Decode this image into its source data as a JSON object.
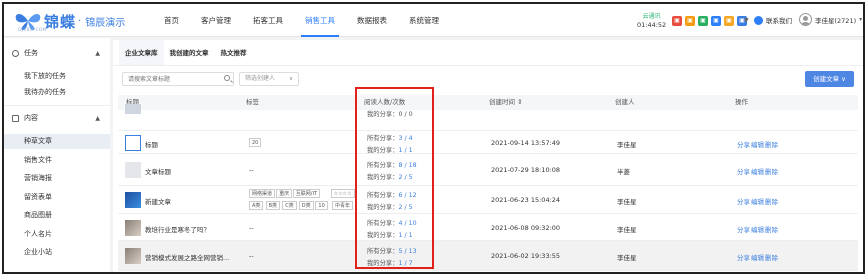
{
  "brand": {
    "name": "锦蝶",
    "dot": "·",
    "product": "锦辰演示",
    "url": "GJCRM.COM"
  },
  "nav": [
    {
      "label": "首页"
    },
    {
      "label": "客户管理"
    },
    {
      "label": "拓客工具"
    },
    {
      "label": "销售工具",
      "active": true
    },
    {
      "label": "数据报表"
    },
    {
      "label": "系统管理"
    }
  ],
  "clock": {
    "label": "云通讯",
    "time": "01:44:52"
  },
  "header_icons": [
    {
      "name": "app-icon-red",
      "color": "#e84c3d",
      "glyph": "▣"
    },
    {
      "name": "app-icon-orange",
      "color": "#f39c12",
      "glyph": "▣"
    },
    {
      "name": "app-icon-green",
      "color": "#27ae60",
      "glyph": "▣"
    },
    {
      "name": "app-icon-blue",
      "color": "#2d7ff9",
      "glyph": "▣"
    },
    {
      "name": "app-icon-orange2",
      "color": "#f5a623",
      "glyph": "▣"
    },
    {
      "name": "app-icon-blue2",
      "color": "#3a7ee0",
      "glyph": "▣"
    }
  ],
  "contact_label": "联系我们",
  "user_label": "李佳星(2721)",
  "sidebar": {
    "task_section": "任务",
    "task_items": [
      {
        "label": "我下放的任务"
      },
      {
        "label": "我待办的任务"
      }
    ],
    "content_section": "内容",
    "content_items": [
      {
        "label": "种草文章",
        "active": true
      },
      {
        "label": "销售文件"
      },
      {
        "label": "营销海报"
      },
      {
        "label": "留资表单"
      },
      {
        "label": "商品图册"
      },
      {
        "label": "个人名片"
      },
      {
        "label": "企业小站"
      }
    ]
  },
  "tabs": [
    {
      "label": "企业文章库",
      "active": true
    },
    {
      "label": "我创建的文章"
    },
    {
      "label": "热文推荐"
    }
  ],
  "filters": {
    "search_placeholder": "请搜索文章标题",
    "creator_placeholder": "筛选创建人",
    "chevron": "∨"
  },
  "create_button": "创建文章 ∨",
  "table": {
    "headers": {
      "title": "标题",
      "tags": "标签",
      "reads": "阅读人数/次数",
      "created": "创建时间 ⇕",
      "creator": "创建人",
      "ops": "操作"
    },
    "partial_row": {
      "mine": "我的分享：0 / 0"
    },
    "rows": [
      {
        "title": "标题",
        "thumb": "blue-logo",
        "tags": [
          "20"
        ],
        "all_label": "所有分享：",
        "all_value": "3 / 4",
        "mine_label": "我的分享：",
        "mine_value": "1 / 1",
        "created": "2021-09-14 13:57:49",
        "creator": "李佳星",
        "ops": [
          "分享",
          "编辑",
          "删除"
        ]
      },
      {
        "title": "文章标题",
        "thumb": "doc-gray",
        "tags_text": "--",
        "all_label": "所有分享：",
        "all_value": "8 / 18",
        "mine_label": "我的分享：",
        "mine_value": "2 / 5",
        "created": "2021-07-29 18:10:08",
        "creator": "半菱",
        "ops": [
          "分享",
          "编辑",
          "删除"
        ]
      },
      {
        "title": "新建文章",
        "thumb": "blue-photo",
        "tags_line1": [
          "网络渠道",
          "重庆",
          "互联网/IT",
          "☆☆☆☆"
        ],
        "tags_line2": [
          "A类",
          "B类",
          "C类",
          "D类",
          "10",
          "中青年"
        ],
        "all_label": "所有分享：",
        "all_value": "6 / 12",
        "mine_label": "我的分享：",
        "mine_value": "2 / 5",
        "created": "2021-06-23 15:04:24",
        "creator": "李佳星",
        "ops": [
          "分享",
          "编辑",
          "删除"
        ]
      },
      {
        "title": "教培行业是寒冬了吗？",
        "thumb": "photo",
        "tags_text": "--",
        "all_label": "所有分享：",
        "all_value": "4 / 10",
        "mine_label": "我的分享：",
        "mine_value": "1 / 1",
        "created": "2021-06-08 09:32:00",
        "creator": "李佳星",
        "ops": [
          "分享",
          "编辑",
          "删除"
        ]
      },
      {
        "title": "营销模式发展之路全网营销...",
        "thumb": "photo",
        "tags_text": "--",
        "all_label": "所有分享：",
        "all_value": "5 / 13",
        "mine_label": "我的分享：",
        "mine_value": "1 / 7",
        "created": "2021-06-02 19:33:55",
        "creator": "李佳星",
        "ops": [
          "分享",
          "编辑",
          "删除"
        ]
      }
    ]
  },
  "colors": {
    "accent": "#2d7ff9",
    "highlight": "#e0221b",
    "button": "#4e86e4"
  }
}
